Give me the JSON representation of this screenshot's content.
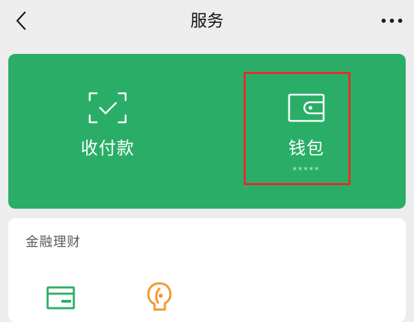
{
  "nav": {
    "title": "服务",
    "back_icon": "back-chevron-icon",
    "more_icon": "more-dots-icon"
  },
  "main_card": {
    "background": "#2aae67",
    "items": [
      {
        "label": "收付款",
        "icon": "scan-check-icon"
      },
      {
        "label": "钱包",
        "sub": "*****",
        "icon": "wallet-icon"
      }
    ]
  },
  "highlight_color": "#e52b2b",
  "finance": {
    "title": "金融理财",
    "icons": [
      "card-icon",
      "wealth-icon"
    ],
    "icon_colors": [
      "#2aae67",
      "#f29a34"
    ]
  }
}
